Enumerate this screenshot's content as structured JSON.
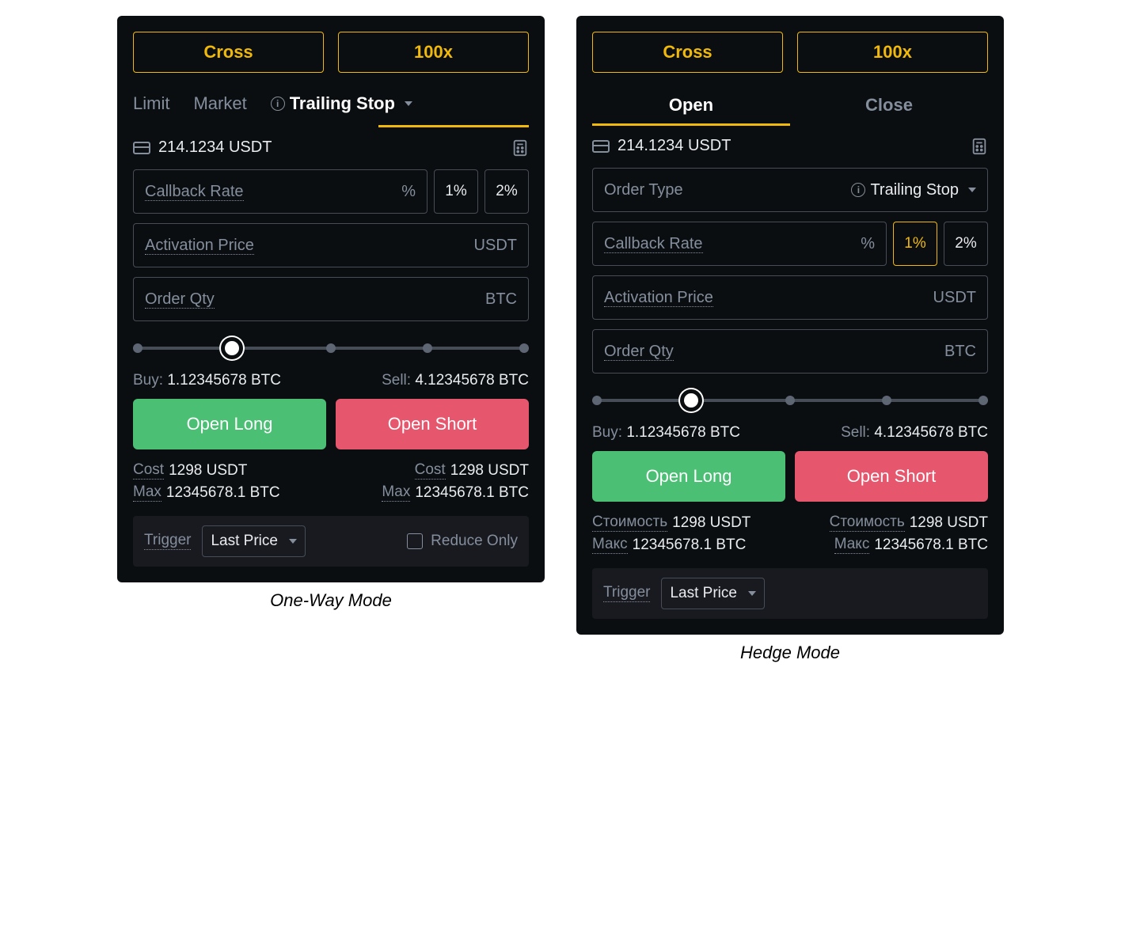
{
  "left": {
    "caption": "One-Way Mode",
    "margin_mode": "Cross",
    "leverage": "100x",
    "tabs": {
      "limit": "Limit",
      "market": "Market",
      "trailing": "Trailing Stop"
    },
    "balance": "214.1234 USDT",
    "callback_label": "Callback Rate",
    "callback_unit": "%",
    "chip_1": "1%",
    "chip_2": "2%",
    "activation_label": "Activation Price",
    "activation_unit": "USDT",
    "qty_label": "Order Qty",
    "qty_unit": "BTC",
    "buy_label": "Buy:",
    "buy_value": "1.12345678 BTC",
    "sell_label": "Sell:",
    "sell_value": "4.12345678 BTC",
    "long_btn": "Open Long",
    "short_btn": "Open Short",
    "cost_label": "Cost",
    "cost_value": "1298 USDT",
    "max_label": "Max",
    "max_value": "12345678.1 BTC",
    "trigger_label": "Trigger",
    "trigger_value": "Last Price",
    "reduce_label": "Reduce Only"
  },
  "right": {
    "caption": "Hedge Mode",
    "margin_mode": "Cross",
    "leverage": "100x",
    "tabs": {
      "open": "Open",
      "close": "Close"
    },
    "balance": "214.1234 USDT",
    "order_type_label": "Order Type",
    "order_type_value": "Trailing Stop",
    "callback_label": "Callback Rate",
    "callback_unit": "%",
    "chip_1": "1%",
    "chip_2": "2%",
    "activation_label": "Activation Price",
    "activation_unit": "USDT",
    "qty_label": "Order Qty",
    "qty_unit": "BTC",
    "buy_label": "Buy:",
    "buy_value": "1.12345678 BTC",
    "sell_label": "Sell:",
    "sell_value": "4.12345678 BTC",
    "long_btn": "Open Long",
    "short_btn": "Open Short",
    "cost_label": "Стоимость",
    "cost_value": "1298 USDT",
    "max_label": "Макс",
    "max_value": "12345678.1 BTC",
    "trigger_label": "Trigger",
    "trigger_value": "Last Price"
  }
}
